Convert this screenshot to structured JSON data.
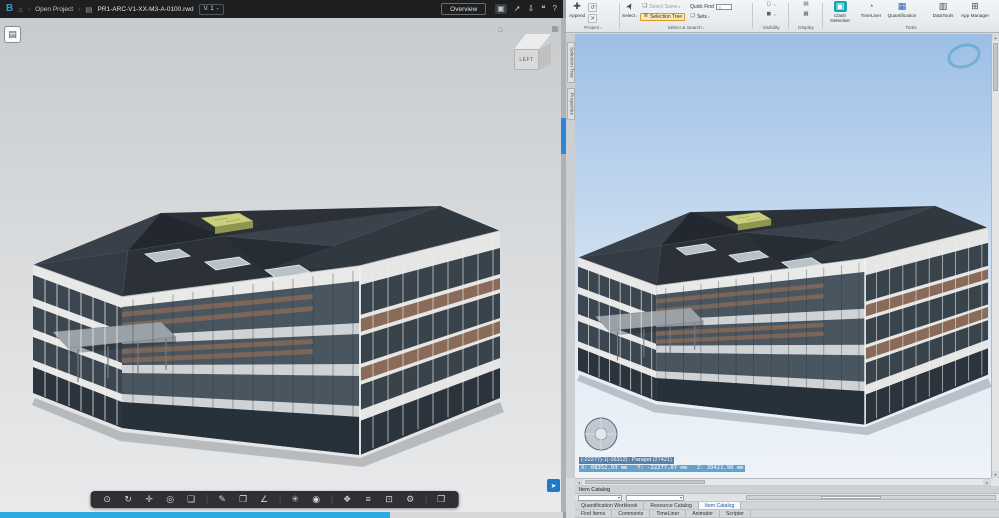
{
  "left_app": {
    "topbar": {
      "logo_letter": "B",
      "breadcrumb": {
        "project": "Open Project",
        "filename": "PR1-ARC-V1-XX-M3-A-0100.rwd",
        "version": "V. 1"
      },
      "overview_label": "Overview",
      "action_icons": [
        "present-icon",
        "share-icon",
        "download-icon",
        "comment-icon",
        "help-icon"
      ]
    },
    "viewer": {
      "viewcube_face": "LEFT",
      "toolbar_groups": [
        [
          "walk-icon",
          "orbit-icon",
          "pan-icon",
          "zoom-icon",
          "fit-view-icon"
        ],
        [
          "markup-icon",
          "section-icon",
          "measure-icon"
        ],
        [
          "explode-icon",
          "camera-icon"
        ],
        [
          "model-browser-icon",
          "properties-icon",
          "screenshot-icon",
          "settings-icon"
        ],
        [
          "fullscreen-icon"
        ]
      ]
    }
  },
  "right_app": {
    "ribbon": {
      "project_group": {
        "label": "Project",
        "append": "Append"
      },
      "select_group": {
        "label": "Select & Search",
        "select": "Select",
        "select_same": "Select Same",
        "selection_tree": "Selection Tree",
        "quick_find": "Quick Find",
        "sets": "Sets"
      },
      "visibility_group": {
        "label": "Visibility"
      },
      "display_group": {
        "label": "Display"
      },
      "tools_group": {
        "label": "Tools",
        "clash_detective": "Clash Detective",
        "timeliner": "TimeLiner",
        "quantification": "Quantification",
        "datatools": "DataTools",
        "app_manager": "App Manager"
      }
    },
    "dock_tabs": [
      "Selection Tree",
      "Properties"
    ],
    "viewport": {
      "selection_label": "(-22277)-1(-16312) : Parapet (27421)",
      "coordinates": "X: 08352,93 mm   Y: -22277,07 mm   Z: 39421,98 mm"
    },
    "panel": {
      "title": "Item Catalog",
      "tabs_row1": [
        "Quantification Workbook",
        "Resource Catalog",
        "Item Catalog"
      ],
      "active_tab_row1": "Item Catalog",
      "tabs_row2": [
        "Find Items",
        "Comments",
        "TimeLiner",
        "Animator",
        "Scripter"
      ]
    },
    "colors": {
      "sky_top": "#9dbfe6",
      "selection_highlight_bg": "#5498c6",
      "tab_active_text": "#1f5fae"
    }
  }
}
